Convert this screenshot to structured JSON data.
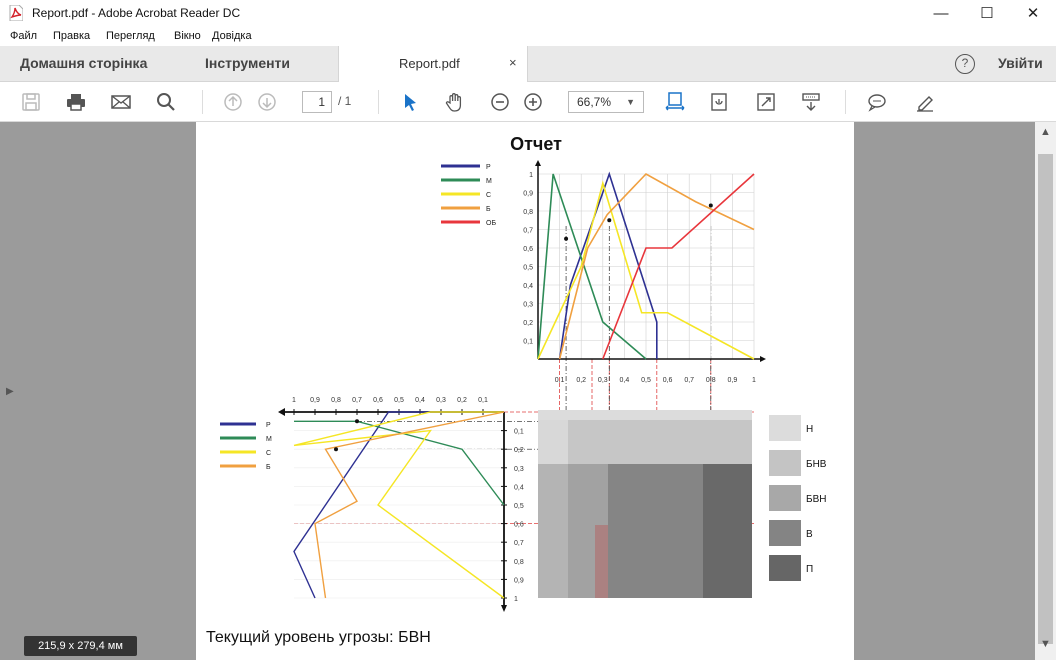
{
  "window": {
    "title": "Report.pdf - Adobe Acrobat Reader DC",
    "minimize": "—",
    "maximize": "☐",
    "close": "✕"
  },
  "menu": [
    "Файл",
    "Правка",
    "Перегляд",
    "Вікно",
    "Довідка"
  ],
  "tabs": {
    "home": "Домашня сторінка",
    "tools": "Інструменти",
    "document": "Report.pdf",
    "close": "×",
    "help": "?",
    "login": "Увійти"
  },
  "toolbar": {
    "page_current": "1",
    "page_total": "/ 1",
    "zoom": "66,7%"
  },
  "page_size_badge": "215,9 x 279,4 мм",
  "document": {
    "title": "Отчет",
    "threat_text": "Текущий уровень угрозы: БВН",
    "upper_legend": [
      {
        "label": "Р",
        "color": "#2e3192"
      },
      {
        "label": "М",
        "color": "#2e8b57"
      },
      {
        "label": "С",
        "color": "#f5e625"
      },
      {
        "label": "Б",
        "color": "#f0a040"
      },
      {
        "label": "ОБ",
        "color": "#e8363c"
      }
    ],
    "lower_legend": [
      {
        "label": "Р",
        "color": "#2e3192"
      },
      {
        "label": "М",
        "color": "#2e8b57"
      },
      {
        "label": "С",
        "color": "#f5e625"
      },
      {
        "label": "Б",
        "color": "#f0a040"
      }
    ],
    "threat_levels": [
      {
        "label": "Н",
        "color": "#dcdcdc"
      },
      {
        "label": "БНВ",
        "color": "#c4c4c4"
      },
      {
        "label": "БВН",
        "color": "#a8a8a8"
      },
      {
        "label": "В",
        "color": "#848484"
      },
      {
        "label": "П",
        "color": "#666666"
      }
    ],
    "upper_y_ticks": [
      "1",
      "0,9",
      "0,8",
      "0,7",
      "0,6",
      "0,5",
      "0,4",
      "0,3",
      "0,2",
      "0,1"
    ],
    "upper_x_ticks": [
      "0,1",
      "0,2",
      "0,3",
      "0,4",
      "0,5",
      "0,6",
      "0,7",
      "0,8",
      "0,9",
      "1"
    ],
    "lower_x_ticks": [
      "1",
      "0,9",
      "0,8",
      "0,7",
      "0,6",
      "0,5",
      "0,4",
      "0,3",
      "0,2",
      "0,1"
    ],
    "lower_y_ticks": [
      "0,1",
      "0,2",
      "0,3",
      "0,4",
      "0,5",
      "0,6",
      "0,7",
      "0,8",
      "0,9",
      "1"
    ]
  },
  "chart_data": [
    {
      "type": "line",
      "xlim": [
        0,
        1
      ],
      "ylim": [
        0,
        1
      ],
      "series": [
        {
          "name": "Р",
          "color": "#2e3192",
          "x": [
            0.1,
            0.15,
            0.33,
            0.55,
            0.55
          ],
          "y": [
            0,
            0.4,
            1,
            0.2,
            0
          ]
        },
        {
          "name": "М",
          "color": "#2e8b57",
          "x": [
            0,
            0.07,
            0.3,
            0.5
          ],
          "y": [
            0,
            1,
            0.2,
            0
          ]
        },
        {
          "name": "С",
          "color": "#f5e625",
          "x": [
            0,
            0.2,
            0.3,
            0.48,
            0.6,
            1
          ],
          "y": [
            0,
            0.5,
            0.95,
            0.25,
            0.25,
            0
          ]
        },
        {
          "name": "Б",
          "color": "#f0a040",
          "x": [
            0.1,
            0.23,
            0.32,
            0.5,
            0.73,
            1
          ],
          "y": [
            0,
            0.6,
            0.78,
            1,
            0.85,
            0.7
          ]
        },
        {
          "name": "ОБ",
          "color": "#e8363c",
          "x": [
            0.3,
            0.5,
            0.62,
            1
          ],
          "y": [
            0,
            0.6,
            0.6,
            1
          ]
        }
      ]
    },
    {
      "type": "line",
      "xlim": [
        1,
        0
      ],
      "ylim": [
        0,
        1
      ],
      "series": [
        {
          "name": "Р",
          "color": "#2e3192",
          "x": [
            0,
            0.55,
            1,
            0.9
          ],
          "y": [
            0,
            0,
            0.75,
            1
          ]
        },
        {
          "name": "М",
          "color": "#2e8b57",
          "x": [
            0,
            0.2,
            0.7,
            1
          ],
          "y": [
            0.5,
            0.2,
            0.05,
            0.05
          ]
        },
        {
          "name": "С",
          "color": "#f5e625",
          "x": [
            0,
            0.6,
            0.35,
            1,
            0.35,
            0
          ],
          "y": [
            1,
            0.5,
            0.1,
            0.18,
            0.0,
            0.0
          ]
        },
        {
          "name": "Б",
          "color": "#f0a040",
          "x": [
            0,
            0.85,
            0.7,
            0.9,
            0.85
          ],
          "y": [
            0,
            0.2,
            0.48,
            0.6,
            1
          ]
        }
      ]
    }
  ]
}
